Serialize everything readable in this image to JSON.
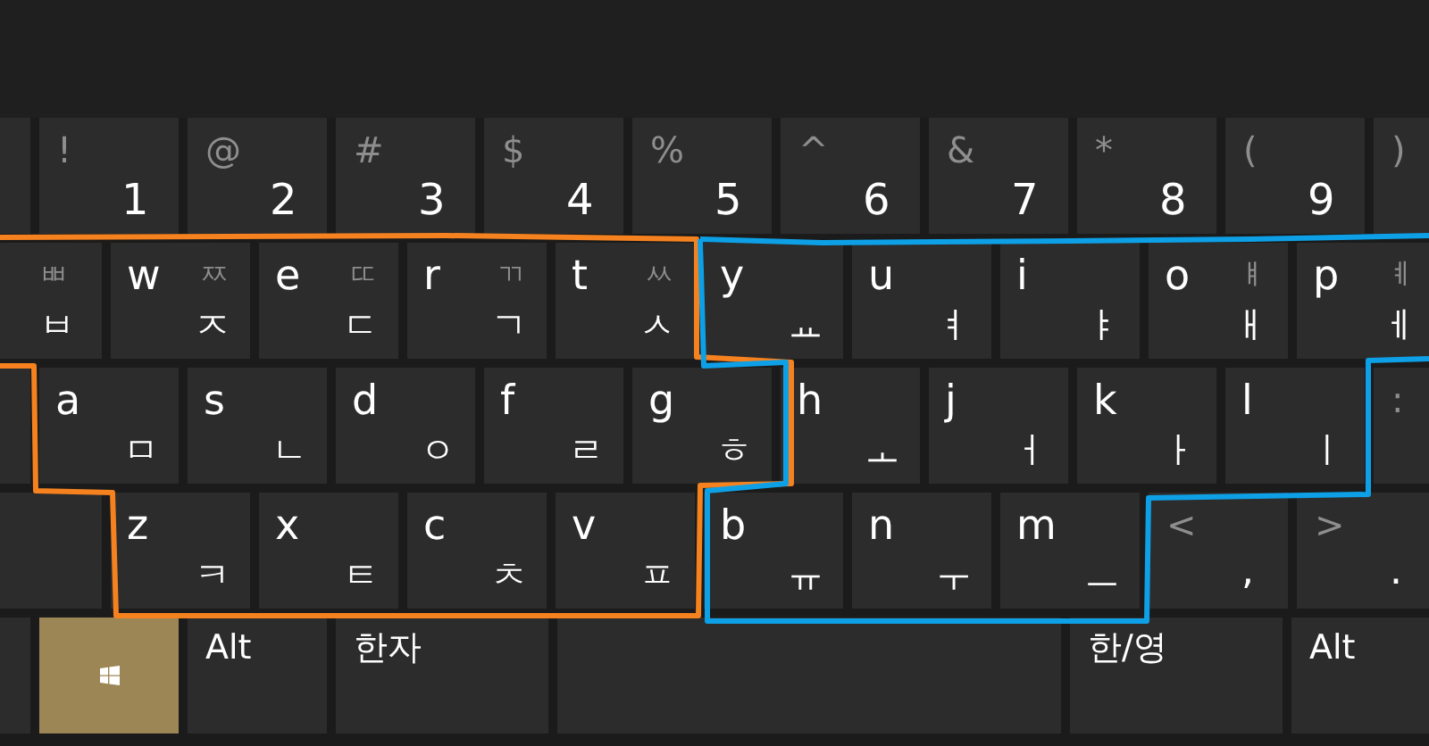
{
  "rows": [
    {
      "keys": [
        {
          "kind": "edge"
        },
        {
          "kind": "digit",
          "shift": "!",
          "main": "1"
        },
        {
          "kind": "digit",
          "shift": "@",
          "main": "2"
        },
        {
          "kind": "digit",
          "shift": "#",
          "main": "3"
        },
        {
          "kind": "digit",
          "shift": "$",
          "main": "4"
        },
        {
          "kind": "digit",
          "shift": "%",
          "main": "5"
        },
        {
          "kind": "digit",
          "shift": "^",
          "main": "6"
        },
        {
          "kind": "digit",
          "shift": "&",
          "main": "7"
        },
        {
          "kind": "digit",
          "shift": "*",
          "main": "8"
        },
        {
          "kind": "digit",
          "shift": "(",
          "main": "9"
        },
        {
          "kind": "digit",
          "shift": ")"
        }
      ]
    },
    {
      "keys": [
        {
          "kind": "wide-edge",
          "shift": "ㅃ",
          "hangul": "ㅂ"
        },
        {
          "kind": "letter",
          "latin": "w",
          "shift": "ㅉ",
          "hangul": "ㅈ"
        },
        {
          "kind": "letter",
          "latin": "e",
          "shift": "ㄸ",
          "hangul": "ㄷ"
        },
        {
          "kind": "letter",
          "latin": "r",
          "shift": "ㄲ",
          "hangul": "ㄱ"
        },
        {
          "kind": "letter",
          "latin": "t",
          "shift": "ㅆ",
          "hangul": "ㅅ"
        },
        {
          "kind": "letter",
          "latin": "y",
          "hangul": "ㅛ"
        },
        {
          "kind": "letter",
          "latin": "u",
          "hangul": "ㅕ"
        },
        {
          "kind": "letter",
          "latin": "i",
          "hangul": "ㅑ"
        },
        {
          "kind": "letter",
          "latin": "o",
          "shift": "ㅒ",
          "hangul": "ㅐ"
        },
        {
          "kind": "letter",
          "latin": "p",
          "shift": "ㅖ",
          "hangul": "ㅔ"
        }
      ]
    },
    {
      "keys": [
        {
          "kind": "edge"
        },
        {
          "kind": "letter",
          "latin": "a",
          "hangul": "ㅁ"
        },
        {
          "kind": "letter",
          "latin": "s",
          "hangul": "ㄴ"
        },
        {
          "kind": "letter",
          "latin": "d",
          "hangul": "ㅇ"
        },
        {
          "kind": "letter",
          "latin": "f",
          "hangul": "ㄹ"
        },
        {
          "kind": "letter",
          "latin": "g",
          "hangul": "ㅎ"
        },
        {
          "kind": "letter",
          "latin": "h",
          "hangul": "ㅗ"
        },
        {
          "kind": "letter",
          "latin": "j",
          "hangul": "ㅓ"
        },
        {
          "kind": "letter",
          "latin": "k",
          "hangul": "ㅏ"
        },
        {
          "kind": "letter",
          "latin": "l",
          "hangul": "ㅣ"
        },
        {
          "kind": "digit",
          "shift": ":"
        }
      ]
    },
    {
      "keys": [
        {
          "kind": "wide-edge"
        },
        {
          "kind": "letter",
          "latin": "z",
          "hangul": "ㅋ"
        },
        {
          "kind": "letter",
          "latin": "x",
          "hangul": "ㅌ"
        },
        {
          "kind": "letter",
          "latin": "c",
          "hangul": "ㅊ"
        },
        {
          "kind": "letter",
          "latin": "v",
          "hangul": "ㅍ"
        },
        {
          "kind": "letter",
          "latin": "b",
          "hangul": "ㅠ"
        },
        {
          "kind": "letter",
          "latin": "n",
          "hangul": "ㅜ"
        },
        {
          "kind": "letter",
          "latin": "m",
          "hangul": "ㅡ"
        },
        {
          "kind": "punct",
          "shift": "<",
          "main": ","
        },
        {
          "kind": "punct",
          "shift": ">",
          "main": "."
        }
      ]
    },
    {
      "keys": [
        {
          "kind": "edge"
        },
        {
          "kind": "windows"
        },
        {
          "kind": "label",
          "label": "Alt"
        },
        {
          "kind": "label-wide",
          "label": "한자"
        },
        {
          "kind": "space"
        },
        {
          "kind": "label-wide",
          "label": "한/영"
        },
        {
          "kind": "label",
          "label": "Alt"
        }
      ]
    }
  ],
  "outlines": [
    {
      "color": "#f5821f"
    },
    {
      "color": "#0ea0e6"
    }
  ]
}
